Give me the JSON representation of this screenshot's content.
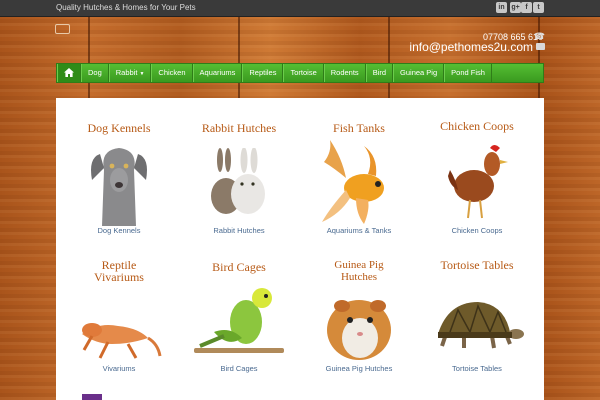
{
  "topbar": {
    "tagline": "Quality Hutches & Homes for Your Pets",
    "social": [
      "linkedin-icon",
      "google-plus-icon",
      "facebook-icon",
      "twitter-icon"
    ]
  },
  "header": {
    "phone": "07708 665 610",
    "email": "info@pethomes2u.com"
  },
  "nav": {
    "items": [
      "Dog",
      "Rabbit",
      "Chicken",
      "Aquariums",
      "Reptiles",
      "Tortoise",
      "Rodents",
      "Bird",
      "Guinea Pig",
      "Pond Fish"
    ]
  },
  "cards": [
    {
      "title": "Dog Kennels",
      "caption": "Dog Kennels"
    },
    {
      "title": "Rabbit Hutches",
      "caption": "Rabbit Hutches"
    },
    {
      "title": "Fish Tanks",
      "caption": "Aquariums & Tanks"
    },
    {
      "title": "Chicken Coops",
      "caption": "Chicken Coops"
    },
    {
      "title": "Reptile Vivariums",
      "caption": "Vivariums"
    },
    {
      "title": "Bird Cages",
      "caption": "Bird Cages"
    },
    {
      "title": "Guinea Pig Hutches",
      "caption": "Guinea Pig Hutches"
    },
    {
      "title": "Tortoise Tables",
      "caption": "Tortoise Tables"
    }
  ],
  "colors": {
    "nav_green": "#44a828",
    "title_orange": "#b75a16",
    "caption_blue": "#4a6a90",
    "topbar": "#3a3a3a"
  }
}
